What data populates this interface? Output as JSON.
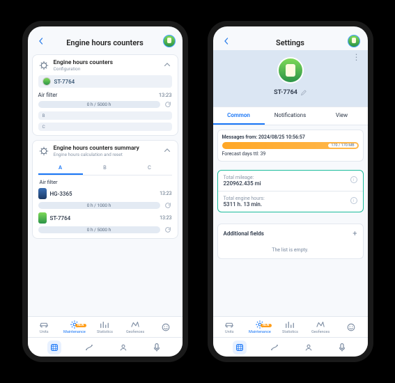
{
  "phone1": {
    "header": {
      "title": "Engine hours counters"
    },
    "card1": {
      "title": "Engine hours counters",
      "subtitle": "Configuration",
      "unit": "ST-7764",
      "filter_label": "Air filter",
      "filter_time": "13:23",
      "progress_text": "0 h / 5000 h",
      "chip_b": "B",
      "chip_c": "C"
    },
    "card2": {
      "title": "Engine hours counters summary",
      "subtitle": "Engine hours calculation and reset",
      "tabs": {
        "a": "A",
        "b": "B",
        "c": "C"
      },
      "group": "Air filter",
      "u1": {
        "name": "HG-3365",
        "time": "13:23",
        "progress": "0 h / 1000 h"
      },
      "u2": {
        "name": "ST-7764",
        "time": "13:23",
        "progress": "0 h / 5000 h"
      }
    },
    "nav": {
      "units": "Units",
      "maintenance": "Maintenance",
      "statistics": "Statistics",
      "geofences": "Geofences",
      "badge": "NEW"
    }
  },
  "phone2": {
    "header": {
      "title": "Settings"
    },
    "hero": {
      "unit": "ST-7764"
    },
    "tabs": {
      "common": "Common",
      "notifications": "Notifications",
      "view": "View"
    },
    "messages": {
      "from_label": "Messages from: 2024/08/25 10:56:57",
      "traffic": "170 / 170 MB",
      "forecast": "Forecast days ttl: 39"
    },
    "info": {
      "mileage_label": "Total mileage:",
      "mileage_value": "220962.435 mi",
      "engine_label": "Total engine hours:",
      "engine_value": "5311 h. 13 min."
    },
    "additional": {
      "title": "Additional fields",
      "empty": "The list is empty."
    },
    "nav": {
      "units": "Units",
      "maintenance": "Maintenance",
      "statistics": "Statistics",
      "geofences": "Geofences",
      "badge": "NEW"
    }
  }
}
